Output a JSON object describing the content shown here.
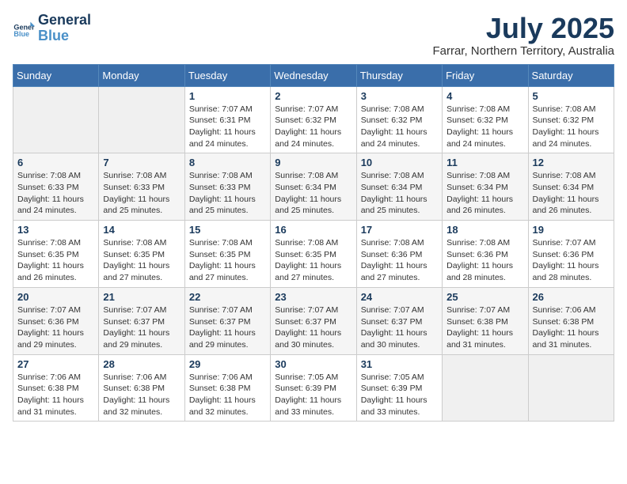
{
  "logo": {
    "line1": "General",
    "line2": "Blue"
  },
  "title": "July 2025",
  "location": "Farrar, Northern Territory, Australia",
  "weekdays": [
    "Sunday",
    "Monday",
    "Tuesday",
    "Wednesday",
    "Thursday",
    "Friday",
    "Saturday"
  ],
  "weeks": [
    [
      {
        "day": "",
        "info": ""
      },
      {
        "day": "",
        "info": ""
      },
      {
        "day": "1",
        "info": "Sunrise: 7:07 AM\nSunset: 6:31 PM\nDaylight: 11 hours and 24 minutes."
      },
      {
        "day": "2",
        "info": "Sunrise: 7:07 AM\nSunset: 6:32 PM\nDaylight: 11 hours and 24 minutes."
      },
      {
        "day": "3",
        "info": "Sunrise: 7:08 AM\nSunset: 6:32 PM\nDaylight: 11 hours and 24 minutes."
      },
      {
        "day": "4",
        "info": "Sunrise: 7:08 AM\nSunset: 6:32 PM\nDaylight: 11 hours and 24 minutes."
      },
      {
        "day": "5",
        "info": "Sunrise: 7:08 AM\nSunset: 6:32 PM\nDaylight: 11 hours and 24 minutes."
      }
    ],
    [
      {
        "day": "6",
        "info": "Sunrise: 7:08 AM\nSunset: 6:33 PM\nDaylight: 11 hours and 24 minutes."
      },
      {
        "day": "7",
        "info": "Sunrise: 7:08 AM\nSunset: 6:33 PM\nDaylight: 11 hours and 25 minutes."
      },
      {
        "day": "8",
        "info": "Sunrise: 7:08 AM\nSunset: 6:33 PM\nDaylight: 11 hours and 25 minutes."
      },
      {
        "day": "9",
        "info": "Sunrise: 7:08 AM\nSunset: 6:34 PM\nDaylight: 11 hours and 25 minutes."
      },
      {
        "day": "10",
        "info": "Sunrise: 7:08 AM\nSunset: 6:34 PM\nDaylight: 11 hours and 25 minutes."
      },
      {
        "day": "11",
        "info": "Sunrise: 7:08 AM\nSunset: 6:34 PM\nDaylight: 11 hours and 26 minutes."
      },
      {
        "day": "12",
        "info": "Sunrise: 7:08 AM\nSunset: 6:34 PM\nDaylight: 11 hours and 26 minutes."
      }
    ],
    [
      {
        "day": "13",
        "info": "Sunrise: 7:08 AM\nSunset: 6:35 PM\nDaylight: 11 hours and 26 minutes."
      },
      {
        "day": "14",
        "info": "Sunrise: 7:08 AM\nSunset: 6:35 PM\nDaylight: 11 hours and 27 minutes."
      },
      {
        "day": "15",
        "info": "Sunrise: 7:08 AM\nSunset: 6:35 PM\nDaylight: 11 hours and 27 minutes."
      },
      {
        "day": "16",
        "info": "Sunrise: 7:08 AM\nSunset: 6:35 PM\nDaylight: 11 hours and 27 minutes."
      },
      {
        "day": "17",
        "info": "Sunrise: 7:08 AM\nSunset: 6:36 PM\nDaylight: 11 hours and 27 minutes."
      },
      {
        "day": "18",
        "info": "Sunrise: 7:08 AM\nSunset: 6:36 PM\nDaylight: 11 hours and 28 minutes."
      },
      {
        "day": "19",
        "info": "Sunrise: 7:07 AM\nSunset: 6:36 PM\nDaylight: 11 hours and 28 minutes."
      }
    ],
    [
      {
        "day": "20",
        "info": "Sunrise: 7:07 AM\nSunset: 6:36 PM\nDaylight: 11 hours and 29 minutes."
      },
      {
        "day": "21",
        "info": "Sunrise: 7:07 AM\nSunset: 6:37 PM\nDaylight: 11 hours and 29 minutes."
      },
      {
        "day": "22",
        "info": "Sunrise: 7:07 AM\nSunset: 6:37 PM\nDaylight: 11 hours and 29 minutes."
      },
      {
        "day": "23",
        "info": "Sunrise: 7:07 AM\nSunset: 6:37 PM\nDaylight: 11 hours and 30 minutes."
      },
      {
        "day": "24",
        "info": "Sunrise: 7:07 AM\nSunset: 6:37 PM\nDaylight: 11 hours and 30 minutes."
      },
      {
        "day": "25",
        "info": "Sunrise: 7:07 AM\nSunset: 6:38 PM\nDaylight: 11 hours and 31 minutes."
      },
      {
        "day": "26",
        "info": "Sunrise: 7:06 AM\nSunset: 6:38 PM\nDaylight: 11 hours and 31 minutes."
      }
    ],
    [
      {
        "day": "27",
        "info": "Sunrise: 7:06 AM\nSunset: 6:38 PM\nDaylight: 11 hours and 31 minutes."
      },
      {
        "day": "28",
        "info": "Sunrise: 7:06 AM\nSunset: 6:38 PM\nDaylight: 11 hours and 32 minutes."
      },
      {
        "day": "29",
        "info": "Sunrise: 7:06 AM\nSunset: 6:38 PM\nDaylight: 11 hours and 32 minutes."
      },
      {
        "day": "30",
        "info": "Sunrise: 7:05 AM\nSunset: 6:39 PM\nDaylight: 11 hours and 33 minutes."
      },
      {
        "day": "31",
        "info": "Sunrise: 7:05 AM\nSunset: 6:39 PM\nDaylight: 11 hours and 33 minutes."
      },
      {
        "day": "",
        "info": ""
      },
      {
        "day": "",
        "info": ""
      }
    ]
  ]
}
